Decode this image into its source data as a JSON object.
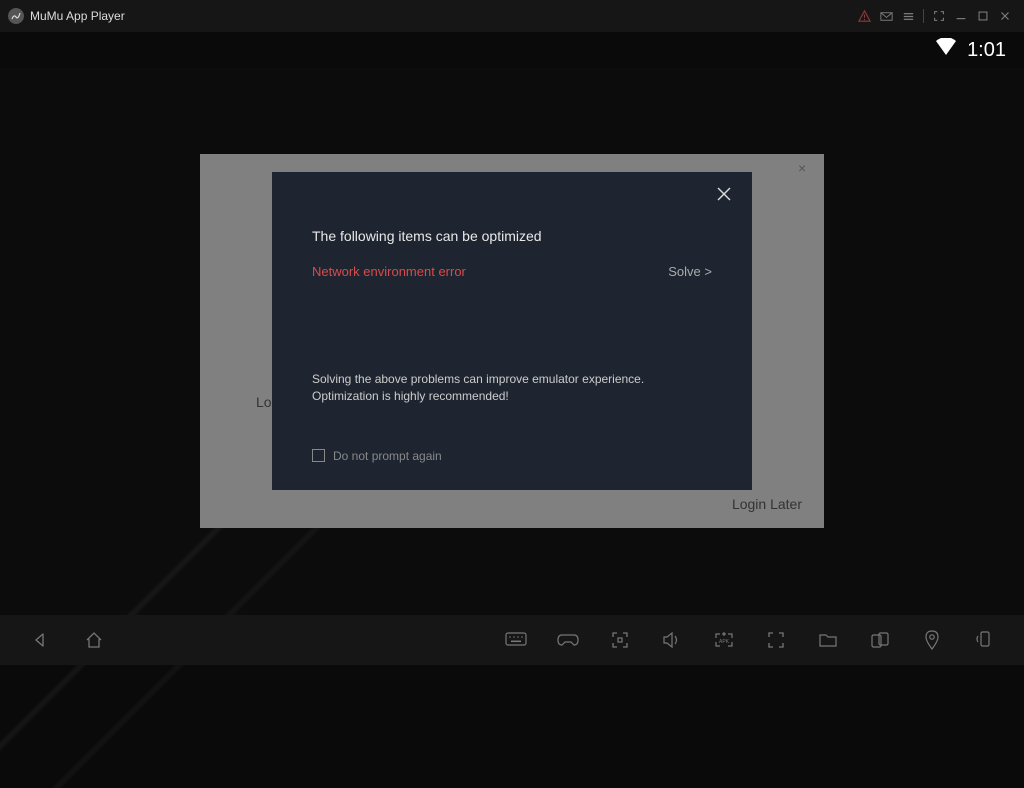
{
  "titlebar": {
    "title": "MuMu App Player"
  },
  "status": {
    "time": "1:01"
  },
  "outer_dialog": {
    "partial_text": "Lo",
    "login_later": "Login Later"
  },
  "optimize_dialog": {
    "heading": "The following items can be optimized",
    "issues": [
      {
        "label": "Network environment error",
        "action": "Solve >"
      }
    ],
    "note_line1": "Solving the above problems can improve emulator experience.",
    "note_line2": "Optimization is highly recommended!",
    "checkbox_label": "Do not prompt again"
  }
}
